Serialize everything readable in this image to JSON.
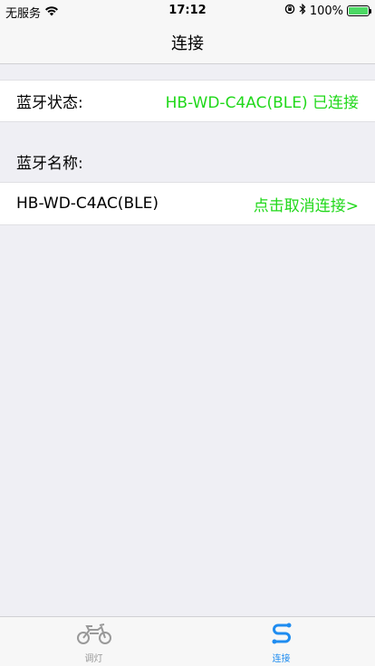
{
  "status_bar": {
    "carrier": "无服务",
    "time": "17:12",
    "battery": "100%",
    "battery_level": 1.0
  },
  "nav": {
    "title": "连接"
  },
  "bluetooth_status": {
    "label": "蓝牙状态:",
    "value": "HB-WD-C4AC(BLE) 已连接"
  },
  "bluetooth_name": {
    "label": "蓝牙名称:"
  },
  "device": {
    "name": "HB-WD-C4AC(BLE)",
    "action": "点击取消连接>"
  },
  "tabs": [
    {
      "label": "调灯",
      "icon": "motorcycle-icon",
      "active": false
    },
    {
      "label": "连接",
      "icon": "connection-icon",
      "active": true
    }
  ],
  "colors": {
    "accent_green": "#20d81a",
    "active_tab": "#1f8cf0",
    "inactive_tab": "#999999"
  }
}
